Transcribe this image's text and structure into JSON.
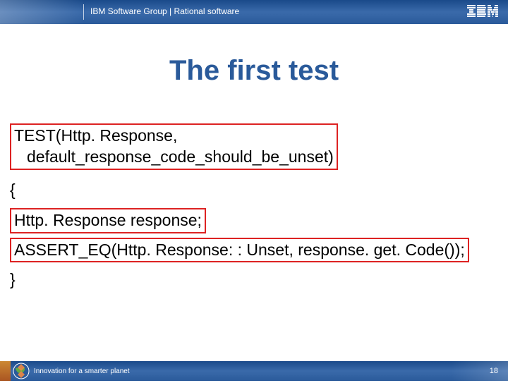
{
  "header": {
    "text": "IBM Software Group | Rational software",
    "logo_label": "IBM"
  },
  "title": "The first test",
  "code": {
    "test_decl_line1": "TEST(Http. Response,",
    "test_decl_line2": "default_response_code_should_be_unset)",
    "open_brace": "{",
    "var_decl": "Http. Response response;",
    "assert_line": "ASSERT_EQ(Http. Response: : Unset, response. get. Code());",
    "close_brace": "}"
  },
  "footer": {
    "tagline": "Innovation for a smarter planet",
    "page_number": "18"
  }
}
